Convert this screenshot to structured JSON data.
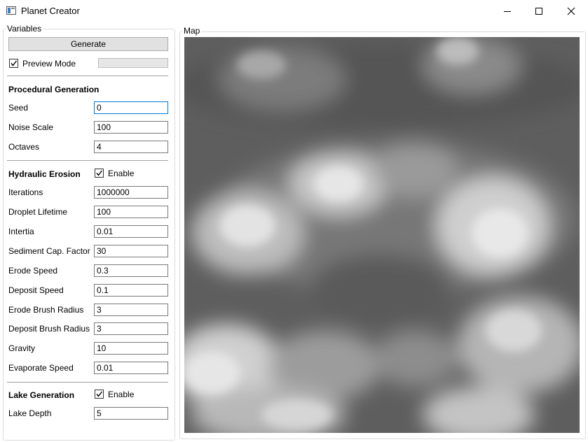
{
  "window": {
    "title": "Planet Creator",
    "icons": {
      "app": "planet-creator-app-icon",
      "minimize": "minimize-icon",
      "maximize": "maximize-icon",
      "close": "close-icon"
    }
  },
  "variables": {
    "group_title": "Variables",
    "generate_label": "Generate",
    "preview_mode": {
      "label": "Preview Mode",
      "checked": true
    },
    "preview_progress": 0,
    "procedural": {
      "heading": "Procedural Generation",
      "seed": {
        "label": "Seed",
        "value": "0"
      },
      "noise_scale": {
        "label": "Noise Scale",
        "value": "100"
      },
      "octaves": {
        "label": "Octaves",
        "value": "4"
      }
    },
    "erosion": {
      "heading": "Hydraulic Erosion",
      "enable": {
        "label": "Enable",
        "checked": true
      },
      "iterations": {
        "label": "Iterations",
        "value": "1000000"
      },
      "droplet_lifetime": {
        "label": "Droplet Lifetime",
        "value": "100"
      },
      "inertia": {
        "label": "Intertia",
        "value": "0.01"
      },
      "sediment_cap": {
        "label": "Sediment Cap. Factor",
        "value": "30"
      },
      "erode_speed": {
        "label": "Erode Speed",
        "value": "0.3"
      },
      "deposit_speed": {
        "label": "Deposit Speed",
        "value": "0.1"
      },
      "erode_brush": {
        "label": "Erode Brush Radius",
        "value": "3"
      },
      "deposit_brush": {
        "label": "Deposit Brush Radius",
        "value": "3"
      },
      "gravity": {
        "label": "Gravity",
        "value": "10"
      },
      "evaporate_speed": {
        "label": "Evaporate Speed",
        "value": "0.01"
      }
    },
    "lake": {
      "heading": "Lake Generation",
      "enable": {
        "label": "Enable",
        "checked": true
      },
      "lake_depth": {
        "label": "Lake Depth",
        "value": "5"
      }
    }
  },
  "map": {
    "group_title": "Map"
  },
  "colors": {
    "terrain_low": "#555555",
    "terrain_high": "#e8e8e8",
    "focus_border": "#0078d7"
  }
}
